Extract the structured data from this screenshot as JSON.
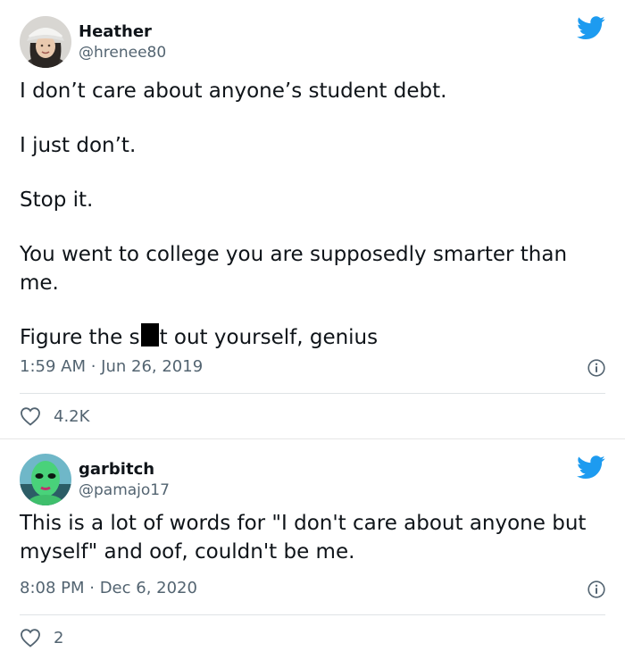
{
  "tweets": [
    {
      "display_name": "Heather",
      "handle": "@hrenee80",
      "lines": [
        "I don’t care about anyone’s student debt.",
        "I just don’t.",
        "Stop it.",
        "You went to college you are supposedly smarter than me."
      ],
      "last_line_before": "Figure the s",
      "last_line_after": "t out yourself, genius",
      "timestamp": "1:59 AM · Jun 26, 2019",
      "likes": "4.2K"
    },
    {
      "display_name": "garbitch",
      "handle": "@pamajo17",
      "text": "This is a lot of words for \"I don't care about anyone but myself\" and oof, couldn't be me.",
      "timestamp": "8:08 PM · Dec 6, 2020",
      "likes": "2"
    }
  ],
  "colors": {
    "twitter_blue": "#1d9bf0",
    "secondary_text": "#536471",
    "primary_text": "#0f1419"
  },
  "icons": {
    "logo": "twitter-bird-icon",
    "info": "info-icon",
    "like": "heart-icon"
  }
}
